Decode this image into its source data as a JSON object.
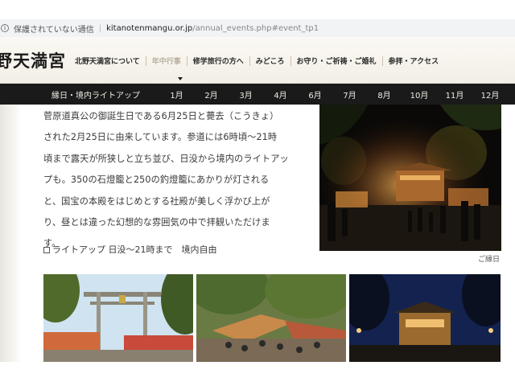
{
  "browser": {
    "security_label": "保護されていない通信",
    "host": "kitanotenmangu.or.jp",
    "path": "/annual_events.php#event_tp1"
  },
  "site": {
    "logo_text": "野天満宮",
    "nav": [
      {
        "label": "北野天満宮について"
      },
      {
        "label": "年中行事",
        "active": true
      },
      {
        "label": "修学旅行の方へ"
      },
      {
        "label": "みどころ"
      },
      {
        "label": "お守り・ご祈祷・ご婚礼"
      },
      {
        "label": "参拝・アクセス"
      }
    ]
  },
  "month_nav": {
    "first": "縁日・境内ライトアップ",
    "months": [
      "1月",
      "2月",
      "3月",
      "4月",
      "6月",
      "7月",
      "8月",
      "10月",
      "11月",
      "12月"
    ]
  },
  "content": {
    "lines": [
      "菅原道真公の御誕生日である6月25日と薨去（こうきょ）",
      "された2月25日に由来しています。参道には6時頃～21時",
      "頃まで露天が所狭しと立ち並び、日没から境内のライトアッ",
      "プも。350の石燈籠と250の釣燈籠にあかりが灯される",
      "と、国宝の本殿をはじめとする社殿が美しく浮かび上が",
      "り、昼とは違った幻想的な雰囲気の中で拝観いただけま",
      "す。"
    ],
    "lightup": "ライトアップ 日没～21時まで　境内自由",
    "photo_caption": "ご縁日"
  }
}
